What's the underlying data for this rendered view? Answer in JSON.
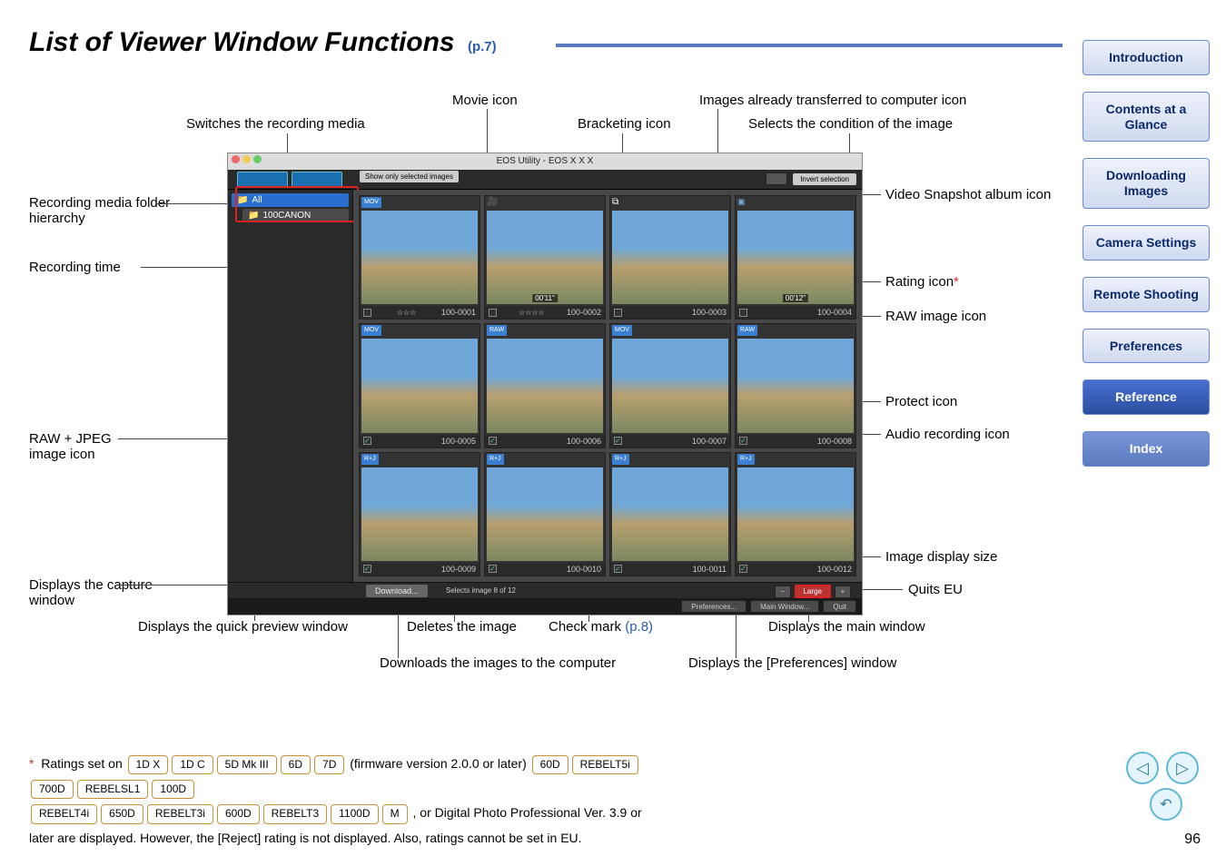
{
  "title": "List of Viewer Window Functions",
  "title_ref": "(p.7)",
  "page_number": "96",
  "nav": {
    "items": [
      "Introduction",
      "Contents at a Glance",
      "Downloading Images",
      "Camera Settings",
      "Remote Shooting",
      "Preferences",
      "Reference",
      "Index"
    ]
  },
  "viewer": {
    "window_title": "EOS Utility - EOS X X X",
    "show_only": "Show only selected images",
    "invert": "Invert selection",
    "tree": {
      "root": "All",
      "child": "100CANON"
    },
    "download": "Download...",
    "selects": "Selects image 8 of 12",
    "zoom_label": "Large",
    "preferences": "Preferences...",
    "main_window": "Main Window...",
    "quit": "Quit",
    "thumbs": [
      {
        "name": "100-0001",
        "badge": "MOV",
        "stars": "☆☆☆"
      },
      {
        "name": "100-0002",
        "badge": "",
        "stars": "☆☆☆☆",
        "time": "00'11\""
      },
      {
        "name": "100-0003",
        "badge": "",
        "stars": ""
      },
      {
        "name": "100-0004",
        "badge": "",
        "stars": "",
        "time": "00'12\""
      },
      {
        "name": "100-0005",
        "badge": "MOV",
        "stars": ""
      },
      {
        "name": "100-0006",
        "badge": "RAW",
        "stars": ""
      },
      {
        "name": "100-0007",
        "badge": "MOV",
        "stars": ""
      },
      {
        "name": "100-0008",
        "badge": "RAW",
        "stars": ""
      },
      {
        "name": "100-0009",
        "badge": "R+J",
        "stars": ""
      },
      {
        "name": "100-0010",
        "badge": "R+J",
        "stars": ""
      },
      {
        "name": "100-0011",
        "badge": "R+J",
        "stars": ""
      },
      {
        "name": "100-0012",
        "badge": "R+J",
        "stars": ""
      }
    ]
  },
  "labels": {
    "switch_media": "Switches the recording media",
    "movie_icon": "Movie icon",
    "bracketing": "Bracketing icon",
    "transferred": "Images already transferred to computer icon",
    "selects_cond": "Selects the condition of the image",
    "rec_media": "Recording media folder hierarchy",
    "rec_time": "Recording time",
    "raw_jpeg": "RAW + JPEG image icon",
    "capture": "Displays the capture window",
    "quick_preview": "Displays the quick preview window",
    "deletes": "Deletes the image",
    "check_mark": "Check mark",
    "check_mark_ref": "(p.8)",
    "downloads": "Downloads the images to the computer",
    "prefs_window": "Displays the [Preferences] window",
    "main_window": "Displays the main window",
    "video_snap": "Video Snapshot album icon",
    "rating": "Rating icon",
    "raw_icon": "RAW image icon",
    "protect": "Protect icon",
    "audio": "Audio recording icon",
    "display_size": "Image display size",
    "quits": "Quits EU"
  },
  "footnote": {
    "prefix": "Ratings set on",
    "fw": "(firmware version 2.0.0 or later)",
    "tail_or": ", or",
    "body": "Digital Photo Professional Ver. 3.9 or later are displayed. However, the [Reject] rating is not displayed. Also, ratings cannot be set in EU.",
    "cameras1": [
      "1D X",
      "1D C",
      "5D Mk III",
      "6D",
      "7D"
    ],
    "cameras2": [
      "60D",
      "REBELT5i",
      "700D",
      "REBELSL1",
      "100D"
    ],
    "cameras3": [
      "REBELT4i",
      "650D",
      "REBELT3i",
      "600D",
      "REBELT3",
      "1100D",
      "M"
    ]
  }
}
